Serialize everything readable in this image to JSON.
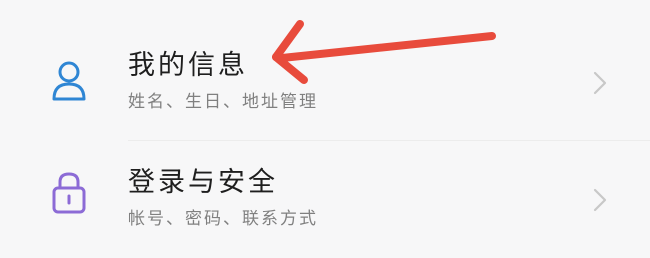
{
  "settings": {
    "items": [
      {
        "title": "我的信息",
        "subtitle": "姓名、生日、地址管理",
        "icon": "person-icon",
        "icon_color": "#2f86d4"
      },
      {
        "title": "登录与安全",
        "subtitle": "帐号、密码、联系方式",
        "icon": "lock-icon",
        "icon_color": "#8c6bd6"
      }
    ]
  },
  "annotation": {
    "arrow_color": "#e84b3c"
  },
  "colors": {
    "title": "#1e1e1e",
    "subtitle": "#808080",
    "chevron": "#c8c8c8",
    "background": "#f7f7f8"
  }
}
